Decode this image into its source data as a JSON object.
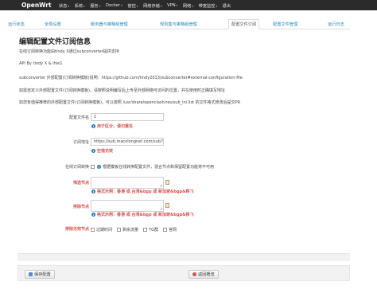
{
  "navbar": {
    "brand": "OpenWrt",
    "menu": [
      "状态",
      "系统",
      "服务",
      "Docker",
      "管控",
      "网络存储",
      "VPN",
      "网络",
      "带宽监控",
      "退出"
    ],
    "dropdown_flags": [
      true,
      true,
      true,
      true,
      true,
      true,
      true,
      true,
      true,
      false
    ]
  },
  "tabs": [
    "运行状态",
    "全局设置",
    "服务器与策略组管理",
    "规则集与策略组管理",
    "配置文件订阅",
    "配置文件管理",
    "运行日志"
  ],
  "active_tab_index": 4,
  "page": {
    "title": "编辑配置文件订阅信息",
    "desc1": "在线订阅转换功能由tindy X通过subconverter提供支持",
    "desc2": "API By tindy X & lhie1",
    "desc3": "subconverter 外部配置(订阅转换模板)说明：https://github.com/tindy2013/subconverter#external-configuration-file",
    "desc4": "如需自定义外部配置文件(订阅转换模板)，请按照说明编写后上传至外部网络可访问的位置，并在使用时正确填写地址",
    "desc5": "如您有值得推荐的外部配置文件(订阅转换模板)，可以按照 /usr/share/openclash/res/sub_ini.list 的文件格式修改后提交PR"
  },
  "form": {
    "name_label": "配置文件名",
    "name_value": "1",
    "name_hint": "用于区分，请勿重名",
    "url_label": "订阅地址",
    "url_value": "https://sub.macolongnet.com/sub?t",
    "url_hint": "空值无效",
    "convert_label": "在线订阅转换",
    "convert_hint": "根据模板在线转换配置文件，混合节点和保留配置功能将不可用",
    "filter_label": "筛选节点",
    "filter_hint": "格式示例：香港 或 台湾&bgp 或 新加坡&bgp&移飞",
    "exclude_label": "排除节点",
    "exclude_hint": "格式示例：香港 或 台湾&bgp 或 新加坡&bgp&移飞",
    "invalid_label": "排除无效节点",
    "invalid_options": [
      "过期时间",
      "剩余流量",
      "TG群",
      "官网"
    ]
  },
  "actions": {
    "save": "保存配置",
    "back": "返回概览"
  },
  "colors": {
    "navbar_bg": "#2b2b2b",
    "link": "#1e88b8",
    "warning": "#d9534f",
    "info_icon": "#2a7ab9"
  }
}
